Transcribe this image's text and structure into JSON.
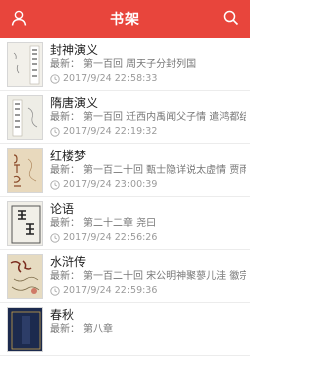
{
  "header": {
    "title": "书架",
    "left_icon": "user-icon",
    "right_icon": "search-icon",
    "bar_color": "#e8453c"
  },
  "latest_label": "最新：",
  "books": [
    {
      "title": "封神演义",
      "latest": "第一百回 周天子分封列国",
      "time": "2017/9/24 22:58:33",
      "cover": "cover-fengshen"
    },
    {
      "title": "隋唐演义",
      "latest": "第一百回 迁西内禹闻父子情 遣鸿都结证隋唐缘",
      "time": "2017/9/24 22:19:32",
      "cover": "cover-suitang"
    },
    {
      "title": "红楼梦",
      "latest": "第一百二十回 甄士隐详说太虚情 贾雨村归结红楼梦",
      "time": "2017/9/24 23:00:39",
      "cover": "cover-hongloumeng"
    },
    {
      "title": "论语",
      "latest": "第二十二章 尧曰",
      "time": "2017/9/24 22:56:26",
      "cover": "cover-lunyu"
    },
    {
      "title": "水浒传",
      "latest": "第一百二十回 宋公明神聚蓼儿洼 徽宗帝梦游梁山泊",
      "time": "2017/9/24 22:59:36",
      "cover": "cover-shuihu"
    },
    {
      "title": "春秋",
      "latest": "第八章",
      "time": "",
      "cover": "cover-chunqiu"
    }
  ]
}
